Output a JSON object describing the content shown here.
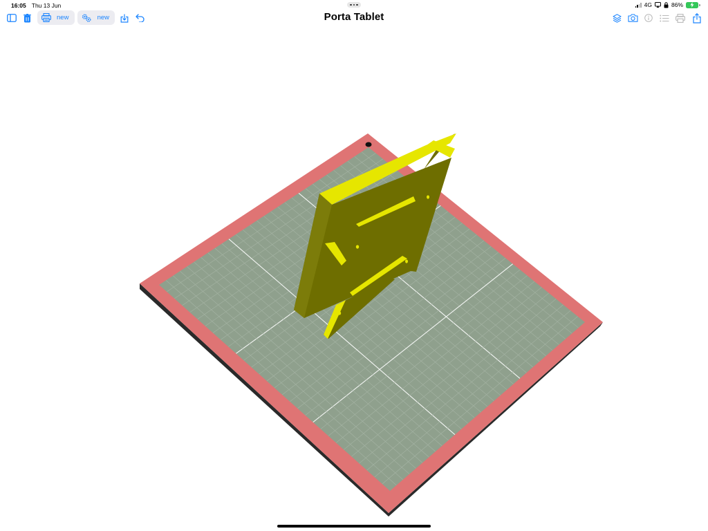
{
  "status_bar": {
    "time": "16:05",
    "date": "Thu 13 Jun",
    "network": "4G",
    "battery_percent": "86%",
    "battery_level": 0.86,
    "icons": [
      "multitask-dots-icon",
      "signal-icon",
      "screen-mirror-icon",
      "lock-rotation-icon",
      "battery-charging-icon"
    ]
  },
  "toolbar": {
    "title": "Porta Tablet",
    "left_tools": [
      {
        "name": "sidebar-toggle-icon"
      },
      {
        "name": "trash-icon"
      },
      {
        "name": "printer-icon",
        "label": "new"
      },
      {
        "name": "gears-icon",
        "label": "new"
      },
      {
        "name": "import-icon"
      },
      {
        "name": "undo-icon"
      }
    ],
    "right_tools": [
      {
        "name": "layers-icon",
        "enabled": true
      },
      {
        "name": "camera-icon",
        "enabled": true
      },
      {
        "name": "info-icon",
        "enabled": false
      },
      {
        "name": "list-icon",
        "enabled": false
      },
      {
        "name": "print-icon",
        "enabled": false
      },
      {
        "name": "share-icon",
        "enabled": true
      }
    ]
  },
  "viewport": {
    "object": "tablet stand model",
    "colors": {
      "bed_border": "#df7474",
      "bed_surface": "#8fa08d",
      "grid_minor": "#a3b2a2",
      "grid_major": "#f4f6f4",
      "model_face_dark": "#6e6e00",
      "model_face_bright": "#e6e600",
      "accent": "#1a84ff"
    }
  }
}
